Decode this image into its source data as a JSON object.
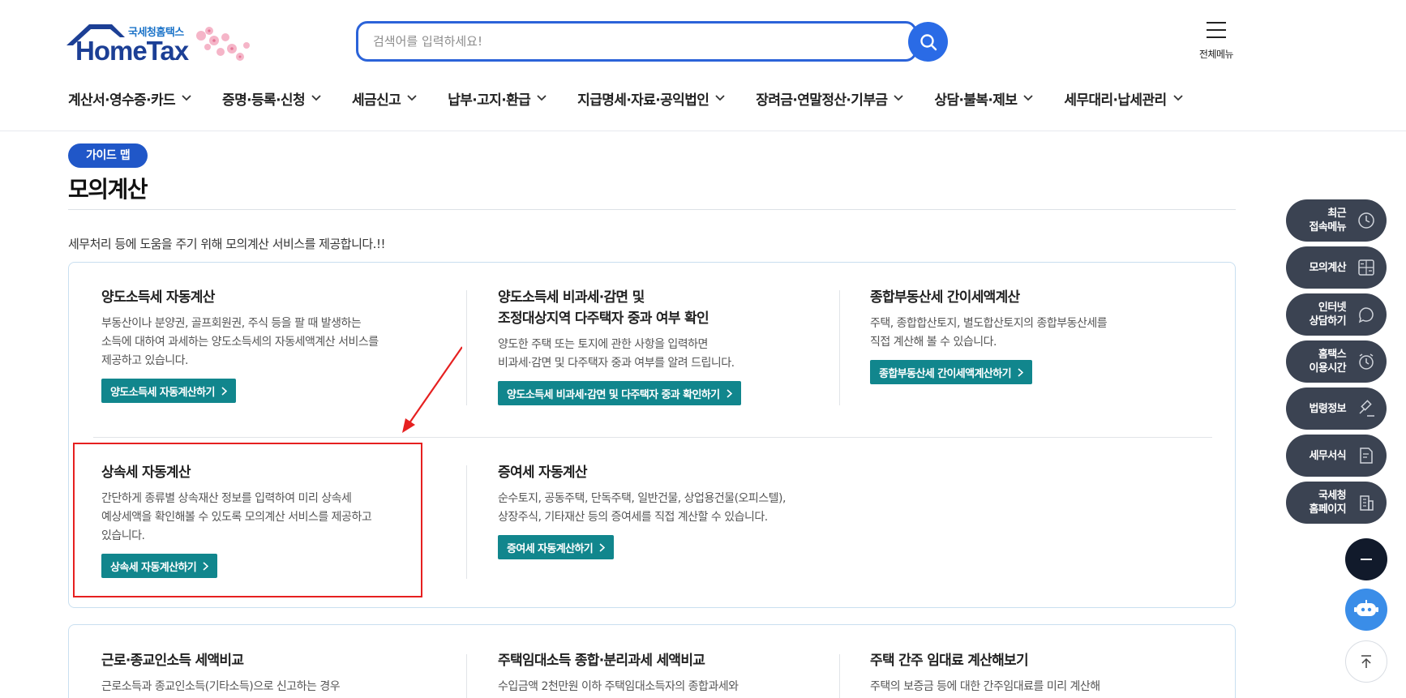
{
  "header": {
    "logo_sub": "국세청홈택스",
    "logo_main": "HomeTax",
    "search_placeholder": "검색어를 입력하세요!",
    "all_menu_label": "전체메뉴"
  },
  "gnb": [
    "계산서·영수증·카드",
    "증명·등록·신청",
    "세금신고",
    "납부·고지·환급",
    "지급명세·자료·공익법인",
    "장려금·연말정산·기부금",
    "상담·불복·제보",
    "세무대리·납세관리"
  ],
  "page": {
    "badge": "가이드 맵",
    "title": "모의계산",
    "intro": "세무처리 등에 도움을 주기 위해 모의계산 서비스를 제공합니다.!!"
  },
  "cards": [
    {
      "title": "양도소득세 자동계산",
      "desc": "부동산이나 분양권, 골프회원권, 주식 등을 팔 때 발생하는\n소득에 대하여 과세하는 양도소득세의 자동세액계산 서비스를\n제공하고 있습니다.",
      "button": "양도소득세 자동계산하기"
    },
    {
      "title": "양도소득세 비과세·감면 및\n조정대상지역 다주택자 중과 여부 확인",
      "desc": "양도한 주택 또는 토지에 관한 사항을 입력하면\n비과세·감면 및 다주택자 중과 여부를 알려 드립니다.",
      "button": "양도소득세 비과세·감면 및 다주택자 중과 확인하기"
    },
    {
      "title": "종합부동산세 간이세액계산",
      "desc": "주택, 종합합산토지, 별도합산토지의 종합부동산세를\n직접 계산해 볼 수 있습니다.",
      "button": "종합부동산세 간이세액계산하기"
    },
    {
      "title": "상속세 자동계산",
      "desc": "간단하게 종류별 상속재산 정보를 입력하여 미리 상속세\n예상세액을 확인해볼 수 있도록 모의계산 서비스를 제공하고\n있습니다.",
      "button": "상속세 자동계산하기"
    },
    {
      "title": "증여세 자동계산",
      "desc": "순수토지, 공동주택, 단독주택, 일반건물, 상업용건물(오피스텔),\n상장주식, 기타재산 등의 증여세를 직접 계산할 수 있습니다.",
      "button": "증여세 자동계산하기"
    }
  ],
  "cards2": [
    {
      "title": "근로·종교인소득 세액비교",
      "desc": "근로소득과 종교인소득(기타소득)으로 신고하는 경우"
    },
    {
      "title": "주택임대소득 종합·분리과세 세액비교",
      "desc": "수입금액 2천만원 이하 주택임대소득자의 종합과세와"
    },
    {
      "title": "주택 간주 임대료 계산해보기",
      "desc": "주택의 보증금 등에 대한 간주임대료를 미리 계산해"
    }
  ],
  "quick_menu": [
    {
      "label": "최근\n접속메뉴",
      "icon": "clock-icon"
    },
    {
      "label": "모의계산",
      "icon": "calculator-icon"
    },
    {
      "label": "인터넷\n상담하기",
      "icon": "chat-icon"
    },
    {
      "label": "홈택스\n이용시간",
      "icon": "alarm-icon"
    },
    {
      "label": "법령정보",
      "icon": "gavel-icon"
    },
    {
      "label": "세무서식",
      "icon": "document-edit-icon"
    },
    {
      "label": "국세청\n홈페이지",
      "icon": "building-icon"
    }
  ],
  "colors": {
    "brand_blue": "#2057c8",
    "button_teal": "#11868d",
    "quick_dark": "#3b4352",
    "highlight_red": "#e62020"
  }
}
